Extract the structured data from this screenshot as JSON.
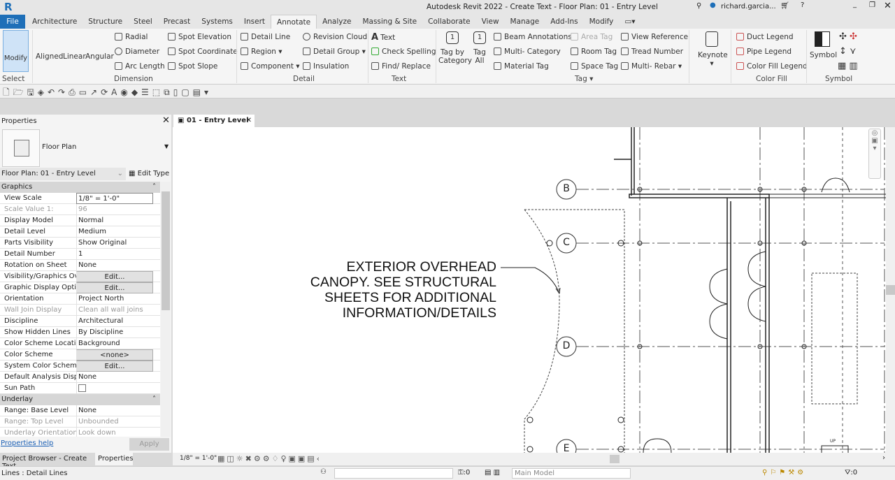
{
  "app": {
    "title": "Autodesk Revit 2022 - Create Text - Floor Plan: 01 - Entry Level",
    "user": "richard.garcia...",
    "logo": "R"
  },
  "tabs": [
    "File",
    "Architecture",
    "Structure",
    "Steel",
    "Precast",
    "Systems",
    "Insert",
    "Annotate",
    "Analyze",
    "Massing & Site",
    "Collaborate",
    "View",
    "Manage",
    "Add-Ins",
    "Modify"
  ],
  "active_tab": "Annotate",
  "ribbon": {
    "select": {
      "modify": "Modify",
      "label": "Select"
    },
    "dimension": {
      "aligned": "Aligned",
      "linear": "Linear",
      "angular": "Angular",
      "radial": "Radial",
      "diameter": "Diameter",
      "arc_length": "Arc  Length",
      "spot_elevation": "Spot  Elevation",
      "spot_coordinate": "Spot  Coordinate",
      "spot_slope": "Spot  Slope",
      "label": "Dimension"
    },
    "detail": {
      "detail_line": "Detail  Line",
      "region": "Region",
      "component": "Component",
      "revision_cloud": "Revision  Cloud",
      "detail_group": "Detail  Group",
      "insulation": "Insulation",
      "label": "Detail"
    },
    "text": {
      "text": "Text",
      "check_spelling": "Check  Spelling",
      "find_replace": "Find/  Replace",
      "label": "Text"
    },
    "tag": {
      "tag_by_category": "Tag by Category",
      "tag_all": "Tag All",
      "beam_annotations": "Beam  Annotations",
      "multi_category": "Multi- Category",
      "material_tag": "Material  Tag",
      "area_tag": "Area  Tag",
      "room_tag": "Room  Tag",
      "space_tag": "Space  Tag",
      "view_reference": "View  Reference",
      "tread_number": "Tread  Number",
      "multi_rebar": "Multi- Rebar",
      "label": "Tag"
    },
    "keynote": {
      "keynote": "Keynote"
    },
    "color_fill": {
      "duct_legend": "Duct  Legend",
      "pipe_legend": "Pipe  Legend",
      "color_fill_legend": "Color Fill  Legend",
      "label": "Color Fill"
    },
    "symbol": {
      "symbol": "Symbol",
      "label": "Symbol"
    }
  },
  "properties": {
    "title": "Properties",
    "type_name": "Floor Plan",
    "selector": "Floor Plan: 01 - Entry Level",
    "edit_type": "Edit Type",
    "groups": [
      {
        "name": "Graphics",
        "rows": [
          {
            "k": "View Scale",
            "v": "1/8\" = 1'-0\""
          },
          {
            "k": "Scale Value    1:",
            "v": "96",
            "dim": true
          },
          {
            "k": "Display Model",
            "v": "Normal"
          },
          {
            "k": "Detail Level",
            "v": "Medium"
          },
          {
            "k": "Parts Visibility",
            "v": "Show Original"
          },
          {
            "k": "Detail Number",
            "v": "1"
          },
          {
            "k": "Rotation on Sheet",
            "v": "None"
          },
          {
            "k": "Visibility/Graphics Ov...",
            "v": "Edit...",
            "btn": true
          },
          {
            "k": "Graphic Display Opti...",
            "v": "Edit...",
            "btn": true
          },
          {
            "k": "Orientation",
            "v": "Project North"
          },
          {
            "k": "Wall Join Display",
            "v": "Clean all wall joins",
            "dim": true
          },
          {
            "k": "Discipline",
            "v": "Architectural"
          },
          {
            "k": "Show Hidden Lines",
            "v": "By Discipline"
          },
          {
            "k": "Color Scheme Location",
            "v": "Background"
          },
          {
            "k": "Color Scheme",
            "v": "<none>",
            "btn": true
          },
          {
            "k": "System Color Schemes",
            "v": "Edit...",
            "btn": true
          },
          {
            "k": "Default Analysis Displ...",
            "v": "None"
          },
          {
            "k": "Sun Path",
            "v": "",
            "checkbox": true,
            "checked": false
          }
        ]
      },
      {
        "name": "Underlay",
        "rows": [
          {
            "k": "Range: Base Level",
            "v": "None"
          },
          {
            "k": "Range: Top Level",
            "v": "Unbounded",
            "dim": true
          },
          {
            "k": "Underlay Orientation",
            "v": "Look down",
            "dim": true
          }
        ]
      }
    ],
    "help": "Properties help",
    "apply": "Apply",
    "bottom_tabs": [
      "Project Browser - Create Text",
      "Properties"
    ]
  },
  "view": {
    "tab": "01 - Entry Level",
    "scale": "1/8\" = 1'-0\"",
    "note": [
      "EXTERIOR OVERHEAD",
      "CANOPY. SEE STRUCTURAL",
      "SHEETS FOR ADDITIONAL",
      "INFORMATION/DETAILS"
    ],
    "grids": [
      "B",
      "C",
      "D",
      "E"
    ],
    "stair_label": "UP"
  },
  "status": {
    "text": "Lines : Detail Lines",
    "workset_count": ":0",
    "model": "Main Model",
    "filter_count": ":0"
  },
  "colors": {
    "file_tab": "#1e6fb8",
    "active_button": "#cfe3f7"
  }
}
